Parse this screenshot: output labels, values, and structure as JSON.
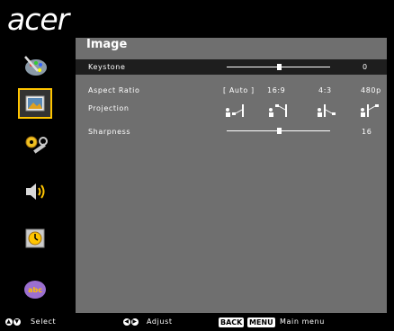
{
  "brand": "acer",
  "panel": {
    "title": "Image"
  },
  "menu": {
    "keystone": {
      "label": "Keystone",
      "value": "0",
      "level": 0.5
    },
    "aspect_ratio": {
      "label": "Aspect Ratio",
      "options": [
        "[ Auto ]",
        "16:9",
        "4:3",
        "480p"
      ]
    },
    "projection": {
      "label": "Projection",
      "icons": [
        "front-desk-projection-icon",
        "front-ceiling-projection-icon",
        "rear-desk-projection-icon",
        "rear-ceiling-projection-icon"
      ]
    },
    "sharpness": {
      "label": "Sharpness",
      "value": "16",
      "level": 0.5
    }
  },
  "sidebar": [
    "color-icon",
    "image-icon",
    "settings-icon",
    "audio-icon",
    "timer-icon",
    "language-icon"
  ],
  "footer": {
    "select_label": "Select",
    "adjust_label": "Adjust",
    "back_key": "BACK",
    "menu_key": "MENU",
    "main_menu_label": "Main menu"
  },
  "colors": {
    "panel": "#6f6f6f",
    "highlight": "#1e1e1e",
    "selection": "#ffc400"
  }
}
